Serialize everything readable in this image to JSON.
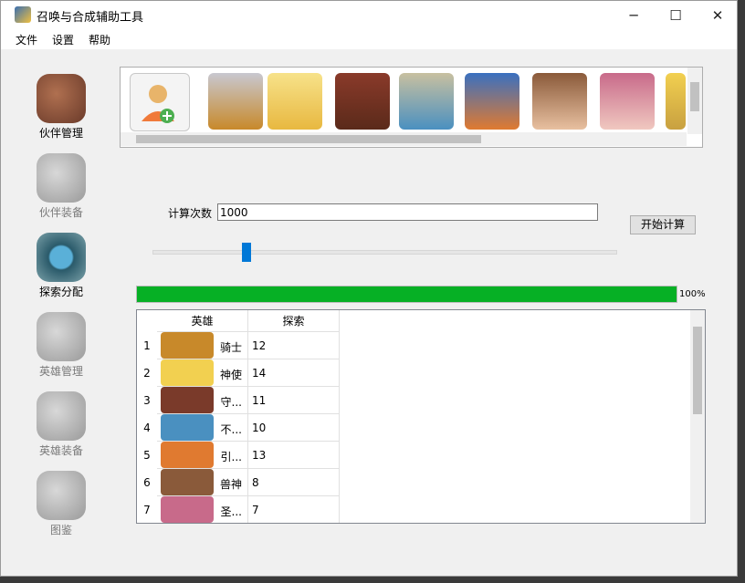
{
  "window": {
    "title": "召唤与合成辅助工具",
    "minimize": "─",
    "maximize": "☐",
    "close": "✕"
  },
  "menu": [
    "文件",
    "设置",
    "帮助"
  ],
  "sidebar": {
    "items": [
      {
        "label": "伙伴管理",
        "icon": "partner-manage-icon",
        "enabled": true
      },
      {
        "label": "伙伴装备",
        "icon": "partner-equip-icon",
        "enabled": false
      },
      {
        "label": "探索分配",
        "icon": "explore-assign-icon",
        "enabled": true
      },
      {
        "label": "英雄管理",
        "icon": "hero-manage-icon",
        "enabled": false
      },
      {
        "label": "英雄装备",
        "icon": "hero-equip-icon",
        "enabled": false
      },
      {
        "label": "图鉴",
        "icon": "codex-icon",
        "enabled": false
      }
    ]
  },
  "portraits": [
    "add-partner-icon",
    "knight-portrait",
    "angel-portrait",
    "guardian-portrait",
    "robot-portrait",
    "fish-portrait",
    "maiden-portrait",
    "beastgirl-portrait",
    "girl-portrait"
  ],
  "calc": {
    "label": "计算次数",
    "value": "1000",
    "button": "开始计算",
    "progress_percent": 100,
    "progress_text": "100%"
  },
  "table": {
    "columns": [
      "英雄",
      "探索"
    ],
    "rows": [
      {
        "num": "1",
        "name": "骑士",
        "explore": "12",
        "color": "#c8892a"
      },
      {
        "num": "2",
        "name": "神使",
        "explore": "14",
        "color": "#f2d050"
      },
      {
        "num": "3",
        "name": "守...",
        "explore": "11",
        "color": "#7a3a2a"
      },
      {
        "num": "4",
        "name": "不...",
        "explore": "10",
        "color": "#4a90c0"
      },
      {
        "num": "5",
        "name": "引...",
        "explore": "13",
        "color": "#e07a30"
      },
      {
        "num": "6",
        "name": "兽神",
        "explore": "8",
        "color": "#8a5a3a"
      },
      {
        "num": "7",
        "name": "圣...",
        "explore": "7",
        "color": "#c86a8a"
      }
    ]
  }
}
